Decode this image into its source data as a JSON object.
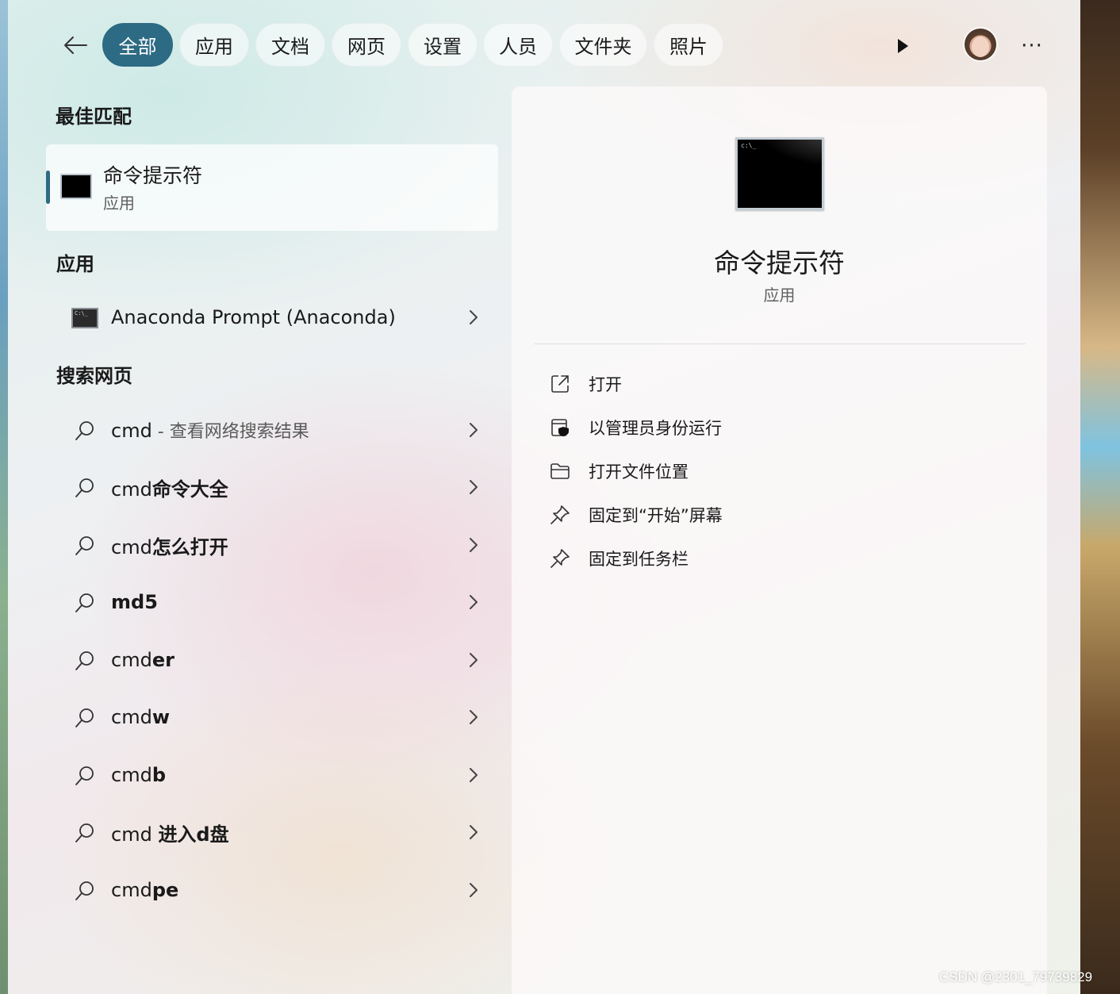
{
  "tabs": [
    {
      "label": "全部",
      "active": true
    },
    {
      "label": "应用",
      "active": false
    },
    {
      "label": "文档",
      "active": false
    },
    {
      "label": "网页",
      "active": false
    },
    {
      "label": "设置",
      "active": false
    },
    {
      "label": "人员",
      "active": false
    },
    {
      "label": "文件夹",
      "active": false
    },
    {
      "label": "照片",
      "active": false
    }
  ],
  "toolbar": {
    "back_icon": "arrow-left-icon",
    "play_icon": "play-icon",
    "more_label": "···"
  },
  "best_match": {
    "section_title": "最佳匹配",
    "name": "命令提示符",
    "type": "应用"
  },
  "apps": {
    "section_title": "应用",
    "items": [
      {
        "label": "Anaconda Prompt (Anaconda)"
      }
    ]
  },
  "web": {
    "section_title": "搜索网页",
    "items": [
      {
        "prefix": "cmd",
        "suffix": "",
        "muted": " - 查看网络搜索结果"
      },
      {
        "prefix": "cmd",
        "suffix": "命令大全",
        "muted": ""
      },
      {
        "prefix": "cmd",
        "suffix": "怎么打开",
        "muted": ""
      },
      {
        "prefix": "",
        "suffix": "md5",
        "muted": ""
      },
      {
        "prefix": "cmd",
        "suffix": "er",
        "muted": ""
      },
      {
        "prefix": "cmd",
        "suffix": "w",
        "muted": ""
      },
      {
        "prefix": "cmd",
        "suffix": "b",
        "muted": ""
      },
      {
        "prefix": "cmd ",
        "suffix": "进入d盘",
        "muted": ""
      },
      {
        "prefix": "cmd",
        "suffix": "pe",
        "muted": ""
      }
    ]
  },
  "detail": {
    "title": "命令提示符",
    "subtitle": "应用",
    "actions": [
      {
        "label": "打开",
        "icon": "open-external-icon"
      },
      {
        "label": "以管理员身份运行",
        "icon": "admin-shield-icon"
      },
      {
        "label": "打开文件位置",
        "icon": "folder-icon"
      },
      {
        "label": "固定到“开始”屏幕",
        "icon": "pin-icon"
      },
      {
        "label": "固定到任务栏",
        "icon": "pin-icon"
      }
    ]
  },
  "watermark": "CSDN @2301_79739829",
  "colors": {
    "accent": "#2d6a83"
  }
}
